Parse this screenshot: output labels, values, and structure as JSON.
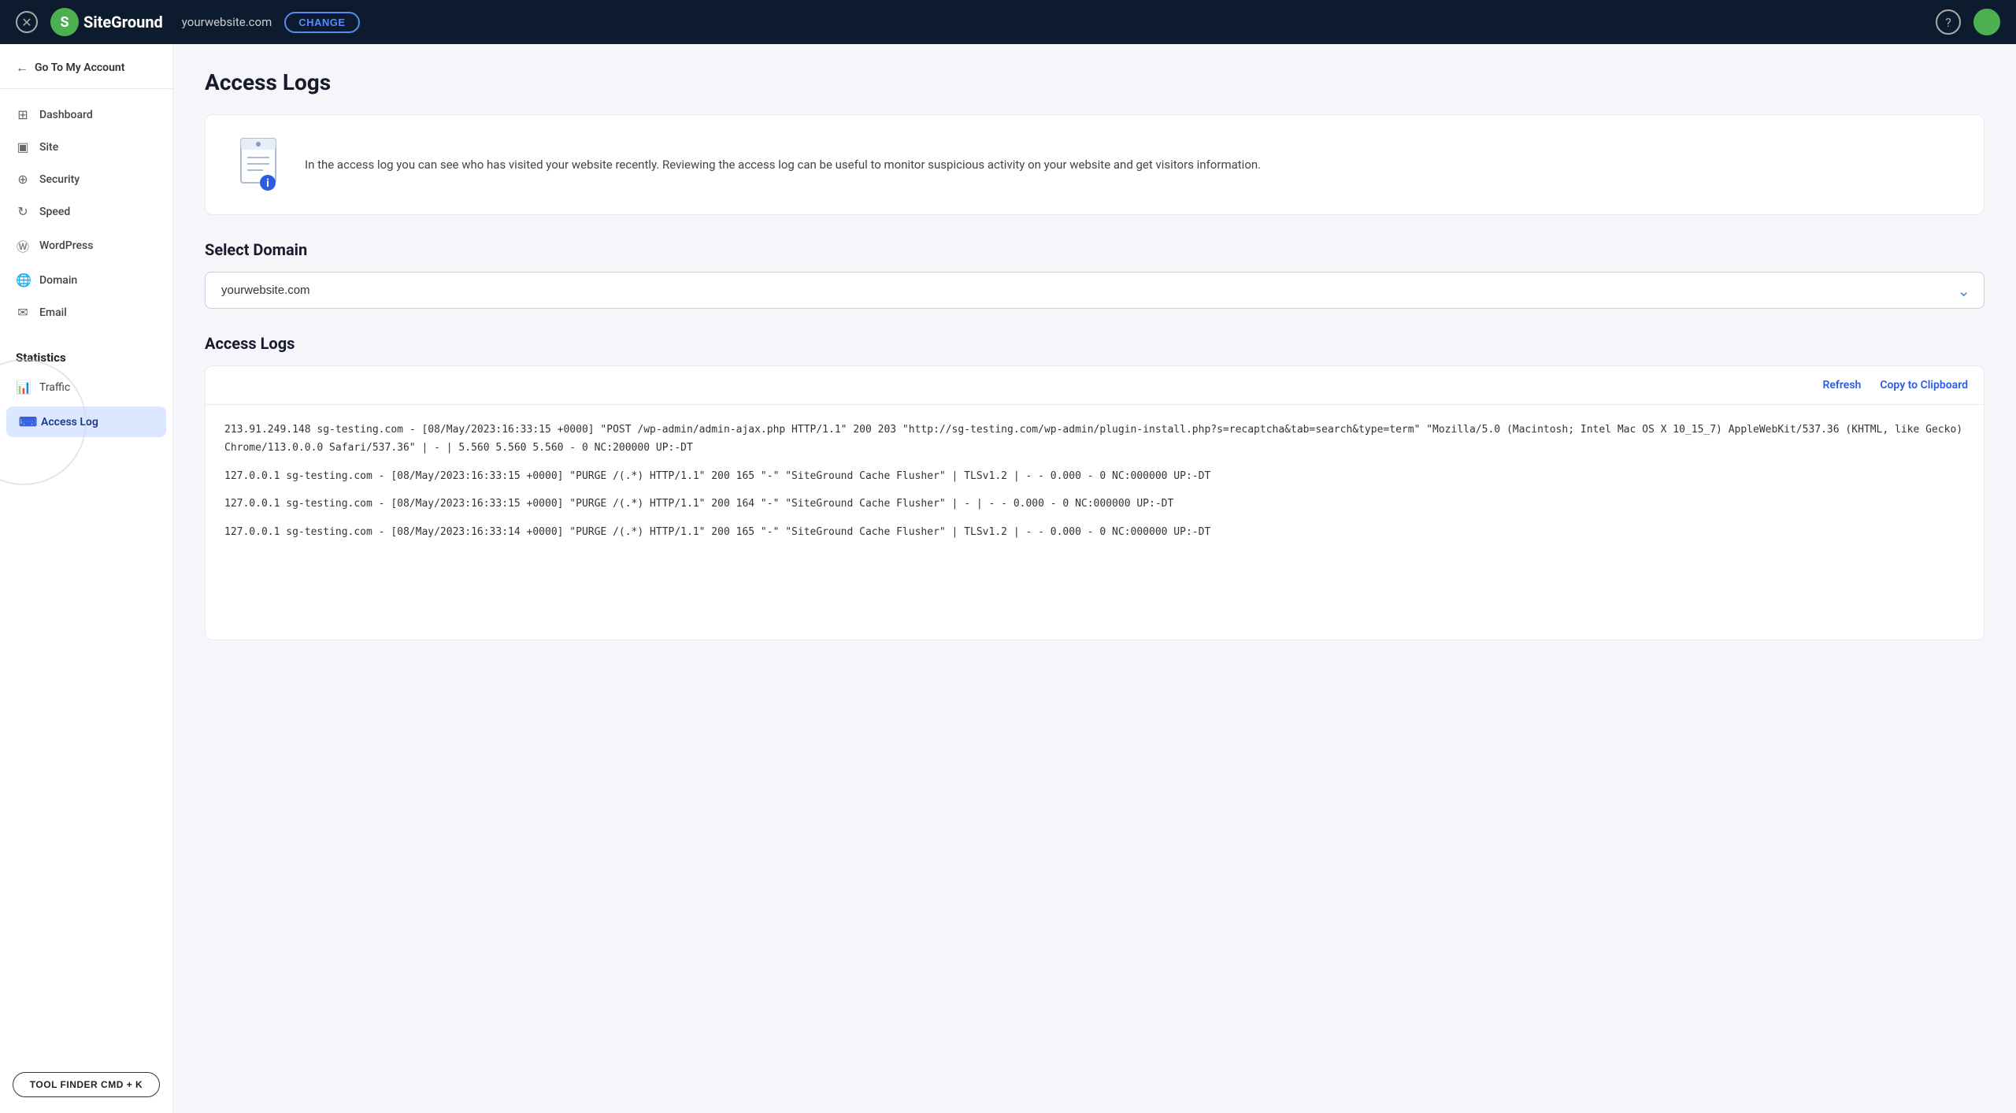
{
  "topnav": {
    "logo_text": "SiteGround",
    "domain": "yourwebsite.com",
    "change_label": "CHANGE",
    "help_symbol": "?",
    "close_symbol": "✕"
  },
  "sidebar": {
    "goto_label": "Go To My Account",
    "nav_items": [
      {
        "id": "dashboard",
        "label": "Dashboard",
        "icon": "⊞"
      },
      {
        "id": "site",
        "label": "Site",
        "icon": "□"
      },
      {
        "id": "security",
        "label": "Security",
        "icon": "⊕"
      },
      {
        "id": "speed",
        "label": "Speed",
        "icon": "↻"
      },
      {
        "id": "wordpress",
        "label": "WordPress",
        "icon": "Ⓦ"
      },
      {
        "id": "domain",
        "label": "Domain",
        "icon": "🌐"
      },
      {
        "id": "email",
        "label": "Email",
        "icon": "✉"
      }
    ],
    "statistics_label": "Statistics",
    "traffic_label": "Traffic",
    "access_log_label": "Access Log",
    "tool_finder_label": "TOOL FINDER CMD + K"
  },
  "main": {
    "page_title": "Access Logs",
    "info_text": "In the access log you can see who has visited your website recently. Reviewing the access log can be useful to monitor suspicious activity on your website and get visitors information.",
    "select_domain_label": "Select Domain",
    "selected_domain": "yourwebsite.com",
    "access_logs_label": "Access Logs",
    "refresh_label": "Refresh",
    "copy_label": "Copy to Clipboard",
    "log_entries": [
      "213.91.249.148 sg-testing.com - [08/May/2023:16:33:15 +0000] \"POST /wp-admin/admin-ajax.php HTTP/1.1\" 200 203 \"http://sg-testing.com/wp-admin/plugin-install.php?s=recaptcha&tab=search&type=term\" \"Mozilla/5.0 (Macintosh; Intel Mac OS X 10_15_7) AppleWebKit/537.36 (KHTML, like Gecko) Chrome/113.0.0.0 Safari/537.36\" | - | 5.560 5.560 5.560 - 0 NC:200000 UP:-DT",
      "127.0.0.1 sg-testing.com - [08/May/2023:16:33:15 +0000] \"PURGE /(.*) HTTP/1.1\" 200 165 \"-\" \"SiteGround Cache Flusher\" | TLSv1.2 | - - 0.000 - 0 NC:000000 UP:-DT",
      "127.0.0.1 sg-testing.com - [08/May/2023:16:33:15 +0000] \"PURGE /(.*) HTTP/1.1\" 200 164 \"-\" \"SiteGround Cache Flusher\" | - | - - 0.000 - 0 NC:000000 UP:-DT",
      "127.0.0.1 sg-testing.com - [08/May/2023:16:33:14 +0000] \"PURGE /(.*) HTTP/1.1\" 200 165 \"-\" \"SiteGround Cache Flusher\" | TLSv1.2 | - - 0.000 - 0 NC:000000 UP:-DT"
    ]
  }
}
